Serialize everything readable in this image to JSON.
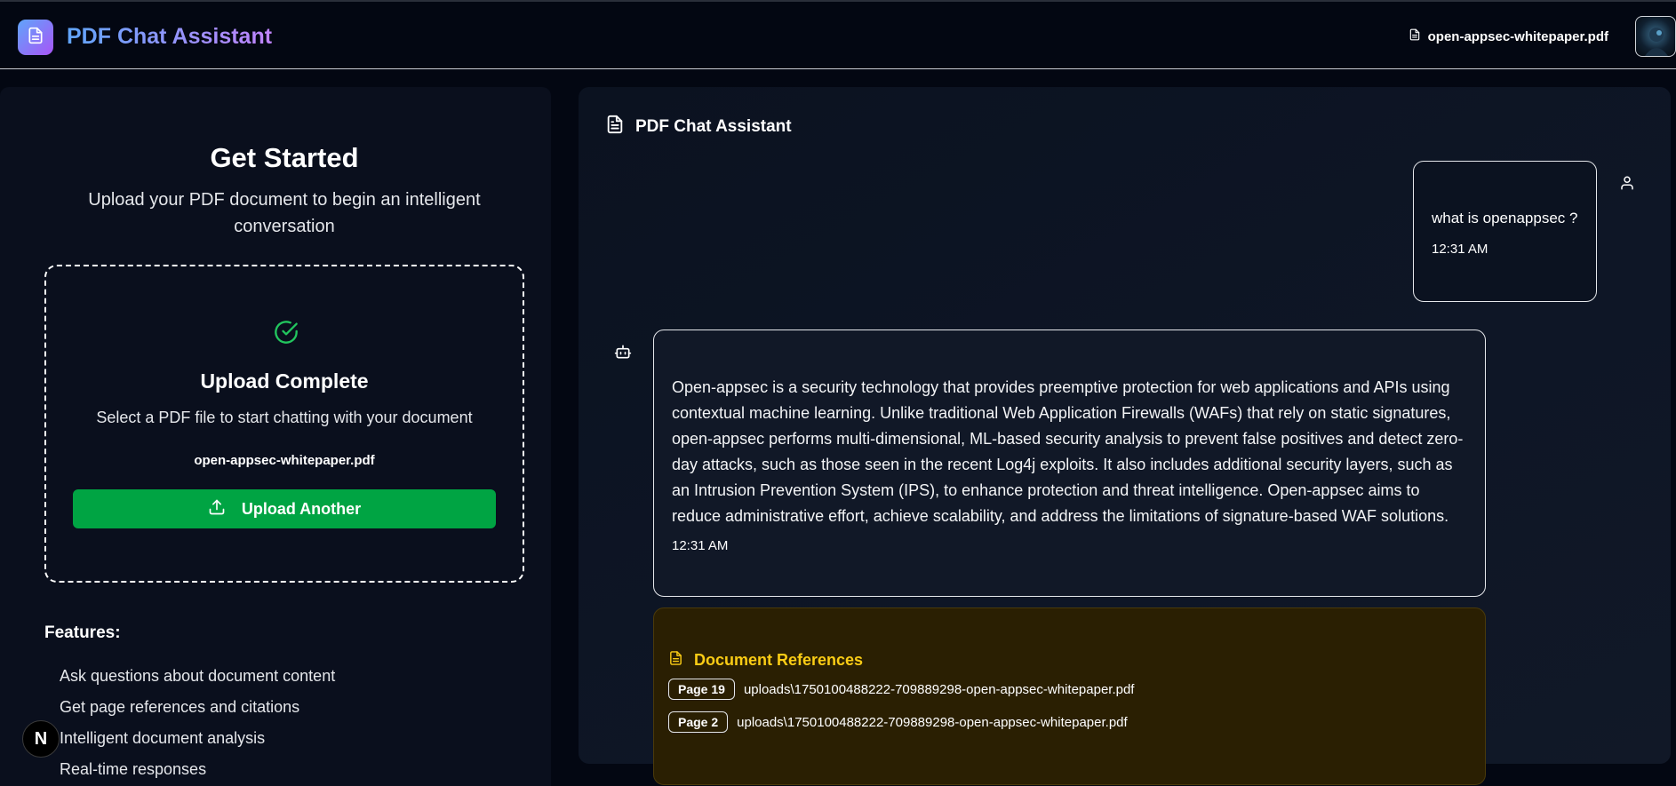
{
  "header": {
    "app_title": "PDF Chat Assistant",
    "current_file": "open-appsec-whitepaper.pdf"
  },
  "sidebar": {
    "title": "Get Started",
    "intro": "Upload your PDF document to begin an intelligent conversation",
    "upload": {
      "status_title": "Upload Complete",
      "status_subtitle": "Select a PDF file to start chatting with your document",
      "file_name": "open-appsec-whitepaper.pdf",
      "button_label": "Upload Another"
    },
    "features": {
      "title": "Features:",
      "items": [
        "Ask questions about document content",
        "Get page references and citations",
        "Intelligent document analysis",
        "Real-time responses"
      ]
    },
    "badge_letter": "N"
  },
  "chat": {
    "title": "PDF Chat Assistant",
    "user_message": {
      "text": "what is openappsec ?",
      "time": "12:31 AM"
    },
    "bot_message": {
      "text": "Open-appsec is a security technology that provides preemptive protection for web applications and APIs using contextual machine learning. Unlike traditional Web Application Firewalls (WAFs) that rely on static signatures, open-appsec performs multi-dimensional, ML-based security analysis to prevent false positives and detect zero-day attacks, such as those seen in the recent Log4j exploits. It also includes additional security layers, such as an Intrusion Prevention System (IPS), to enhance protection and threat intelligence. Open-appsec aims to reduce administrative effort, achieve scalability, and address the limitations of signature-based WAF solutions.",
      "time": "12:31 AM"
    },
    "references": {
      "title": "Document References",
      "items": [
        {
          "page": "Page 19",
          "path": "uploads\\1750100488222-709889298-open-appsec-whitepaper.pdf"
        },
        {
          "page": "Page 2",
          "path": "uploads\\1750100488222-709889298-open-appsec-whitepaper.pdf"
        }
      ]
    }
  },
  "colors": {
    "background": "#030712",
    "accent_green": "#00a443",
    "reference_gold": "#facc15",
    "logo_gradient_start": "#60a5fa",
    "logo_gradient_end": "#a855f7"
  },
  "icons": [
    "file-text-icon",
    "check-circle-icon",
    "upload-icon",
    "user-icon",
    "bot-icon"
  ]
}
